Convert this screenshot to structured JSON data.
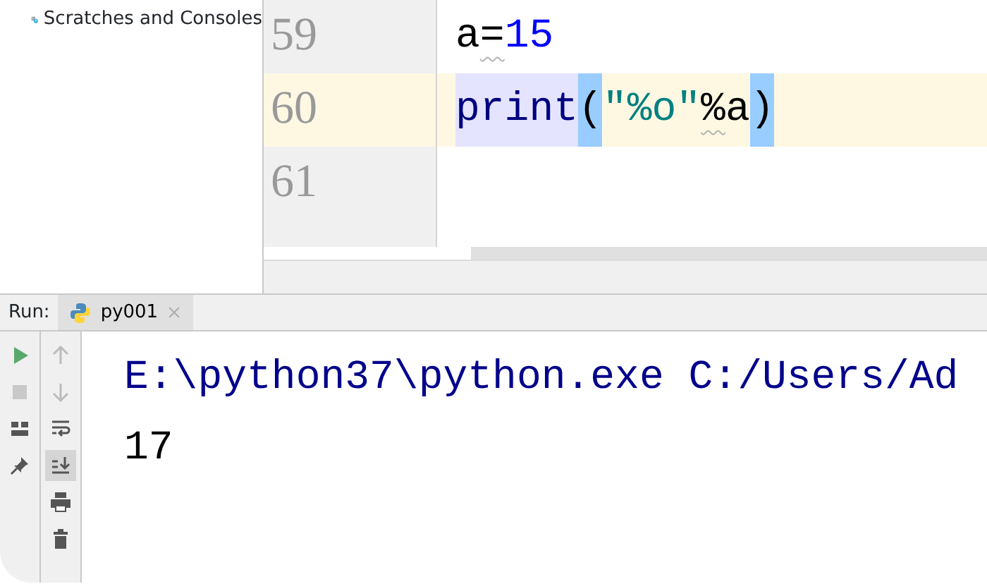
{
  "project_tree": {
    "items": [
      {
        "label": "Scratches and Consoles",
        "kind": "scratches"
      }
    ]
  },
  "editor": {
    "lines": [
      {
        "number": "59",
        "current": false,
        "tokens": [
          {
            "text": "a",
            "kind": "plain",
            "usage_highlight": false,
            "brace_highlight": false,
            "warning": false
          },
          {
            "text": "=",
            "kind": "plain",
            "usage_highlight": false,
            "brace_highlight": false,
            "warning": true
          },
          {
            "text": "15",
            "kind": "number",
            "usage_highlight": false,
            "brace_highlight": false,
            "warning": false
          }
        ]
      },
      {
        "number": "60",
        "current": true,
        "tokens": [
          {
            "text": "print",
            "kind": "builtin",
            "usage_highlight": true,
            "brace_highlight": false,
            "warning": false
          },
          {
            "text": "(",
            "kind": "plain",
            "usage_highlight": false,
            "brace_highlight": true,
            "warning": false
          },
          {
            "text": "\"%o\"",
            "kind": "string",
            "usage_highlight": false,
            "brace_highlight": false,
            "warning": false
          },
          {
            "text": "%",
            "kind": "plain",
            "usage_highlight": false,
            "brace_highlight": false,
            "warning": true
          },
          {
            "text": "a",
            "kind": "plain",
            "usage_highlight": false,
            "brace_highlight": false,
            "warning": false
          },
          {
            "text": ")",
            "kind": "plain",
            "usage_highlight": false,
            "brace_highlight": true,
            "warning": false
          }
        ]
      },
      {
        "number": "61",
        "current": false
      }
    ]
  },
  "run_panel": {
    "label": "Run:",
    "tabs": [
      {
        "label": "py001",
        "selected": true
      }
    ],
    "left_tools": [
      {
        "kind": "run",
        "toggled": false
      },
      {
        "kind": "stop",
        "toggled": false
      },
      {
        "kind": "layout",
        "toggled": false
      },
      {
        "kind": "pin",
        "toggled": false
      }
    ],
    "right_tools": [
      {
        "kind": "up",
        "toggled": false
      },
      {
        "kind": "down",
        "toggled": false
      },
      {
        "kind": "wrap",
        "toggled": false
      },
      {
        "kind": "scroll-end",
        "toggled": true
      },
      {
        "kind": "print",
        "toggled": false
      },
      {
        "kind": "trash",
        "toggled": false
      }
    ],
    "console": [
      {
        "text": "E:\\python37\\python.exe C:/Users/Ad",
        "kind": "command"
      },
      {
        "text": "17",
        "kind": "output"
      }
    ]
  }
}
